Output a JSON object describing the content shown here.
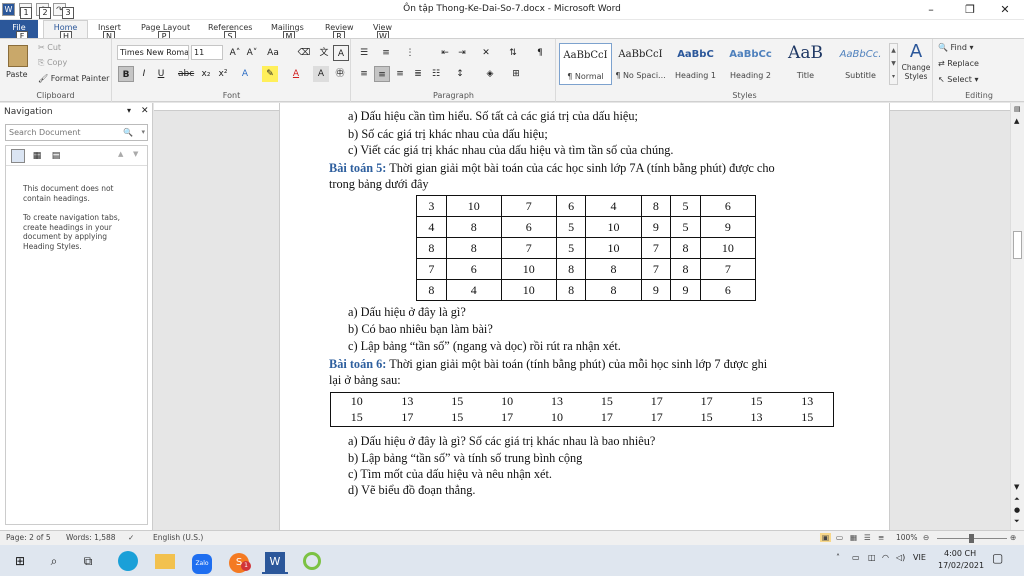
{
  "title_bar": {
    "title": "Ôn tập Thong-Ke-Dai-So-7.docx - Microsoft Word",
    "qat_keytips": [
      "1",
      "2",
      "3"
    ],
    "minimize": "–",
    "restore": "❐",
    "close": "✕"
  },
  "tabs": [
    {
      "label": "File",
      "keytip": "F"
    },
    {
      "label": "Home",
      "keytip": "H"
    },
    {
      "label": "Insert",
      "keytip": "N"
    },
    {
      "label": "Page Layout",
      "keytip": "P"
    },
    {
      "label": "References",
      "keytip": "S"
    },
    {
      "label": "Mailings",
      "keytip": "M"
    },
    {
      "label": "Review",
      "keytip": "R"
    },
    {
      "label": "View",
      "keytip": "W"
    }
  ],
  "ribbon": {
    "clipboard": {
      "paste": "Paste",
      "cut": "Cut",
      "copy": "Copy",
      "format_painter": "Format Painter",
      "label": "Clipboard"
    },
    "font": {
      "font_name": "Times New Roma",
      "font_size": "11",
      "label": "Font"
    },
    "paragraph": {
      "label": "Paragraph"
    },
    "styles": {
      "label": "Styles",
      "items": [
        {
          "sample": "AaBbCcI",
          "name": "¶ Normal"
        },
        {
          "sample": "AaBbCcI",
          "name": "¶ No Spaci..."
        },
        {
          "sample": "AaBbC",
          "name": "Heading 1"
        },
        {
          "sample": "AaBbCc",
          "name": "Heading 2"
        },
        {
          "sample": "AaB",
          "name": "Title"
        },
        {
          "sample": "AaBbCc.",
          "name": "Subtitle"
        }
      ],
      "change_styles": "Change Styles"
    },
    "editing": {
      "find": "Find",
      "replace": "Replace",
      "select": "Select",
      "label": "Editing"
    }
  },
  "navigation": {
    "title": "Navigation",
    "search_placeholder": "Search Document",
    "msg1": "This document does not contain headings.",
    "msg2": "To create navigation tabs, create headings in your document by applying Heading Styles."
  },
  "document": {
    "lines_top": [
      "a)  Dấu hiệu cần tìm hiểu. Số tất cả các giá trị của dấu hiệu;",
      "b)  Số các giá trị khác nhau của dấu hiệu;",
      "c)  Viết các giá trị khác nhau của dấu hiệu và tìm tần số của chúng."
    ],
    "bt5_label": "Bài toán 5:",
    "bt5_text": " Thời gian giải một bài toán của các học sinh lớp 7A (tính bằng phút) được cho",
    "bt5_text2": "trong bảng dưới đây",
    "table5": [
      [
        "3",
        "10",
        "7",
        "6",
        "4",
        "8",
        "5",
        "6"
      ],
      [
        "4",
        "8",
        "6",
        "5",
        "10",
        "9",
        "5",
        "9"
      ],
      [
        "8",
        "8",
        "7",
        "5",
        "10",
        "7",
        "8",
        "10"
      ],
      [
        "7",
        "6",
        "10",
        "8",
        "8",
        "7",
        "8",
        "7"
      ],
      [
        "8",
        "4",
        "10",
        "8",
        "8",
        "9",
        "9",
        "6"
      ]
    ],
    "bt5_questions": [
      "a)  Dấu hiệu ở đây là gì?",
      "b)  Có bao nhiêu bạn làm bài?",
      "c)  Lập bảng “tần số” (ngang và dọc) rồi rút ra nhận xét."
    ],
    "bt6_label": "Bài toán 6:",
    "bt6_text": " Thời gian giải một bài toán (tính bằng phút) của mỗi học sinh lớp 7 được ghi",
    "bt6_text2": "lại ở bảng sau:",
    "table6": [
      [
        "10",
        "13",
        "15",
        "10",
        "13",
        "15",
        "17",
        "17",
        "15",
        "13"
      ],
      [
        "15",
        "17",
        "15",
        "17",
        "10",
        "17",
        "17",
        "15",
        "13",
        "15"
      ]
    ],
    "bt6_questions": [
      "a)  Dấu hiệu ở đây là gì? Số các giá trị khác nhau là bao nhiêu?",
      "b)  Lập bảng “tần số” và tính số trung bình cộng",
      "c)  Tìm mốt của dấu hiệu và nêu nhận xét.",
      "d)  Vẽ biểu đồ đoạn thẳng."
    ]
  },
  "status_bar": {
    "page": "Page: 2 of 5",
    "words": "Words: 1,588",
    "language": "English (U.S.)",
    "zoom": "100%"
  },
  "taskbar": {
    "language": "VIE",
    "time": "4:00 CH",
    "date": "17/02/2021",
    "skype_badge": "1"
  }
}
